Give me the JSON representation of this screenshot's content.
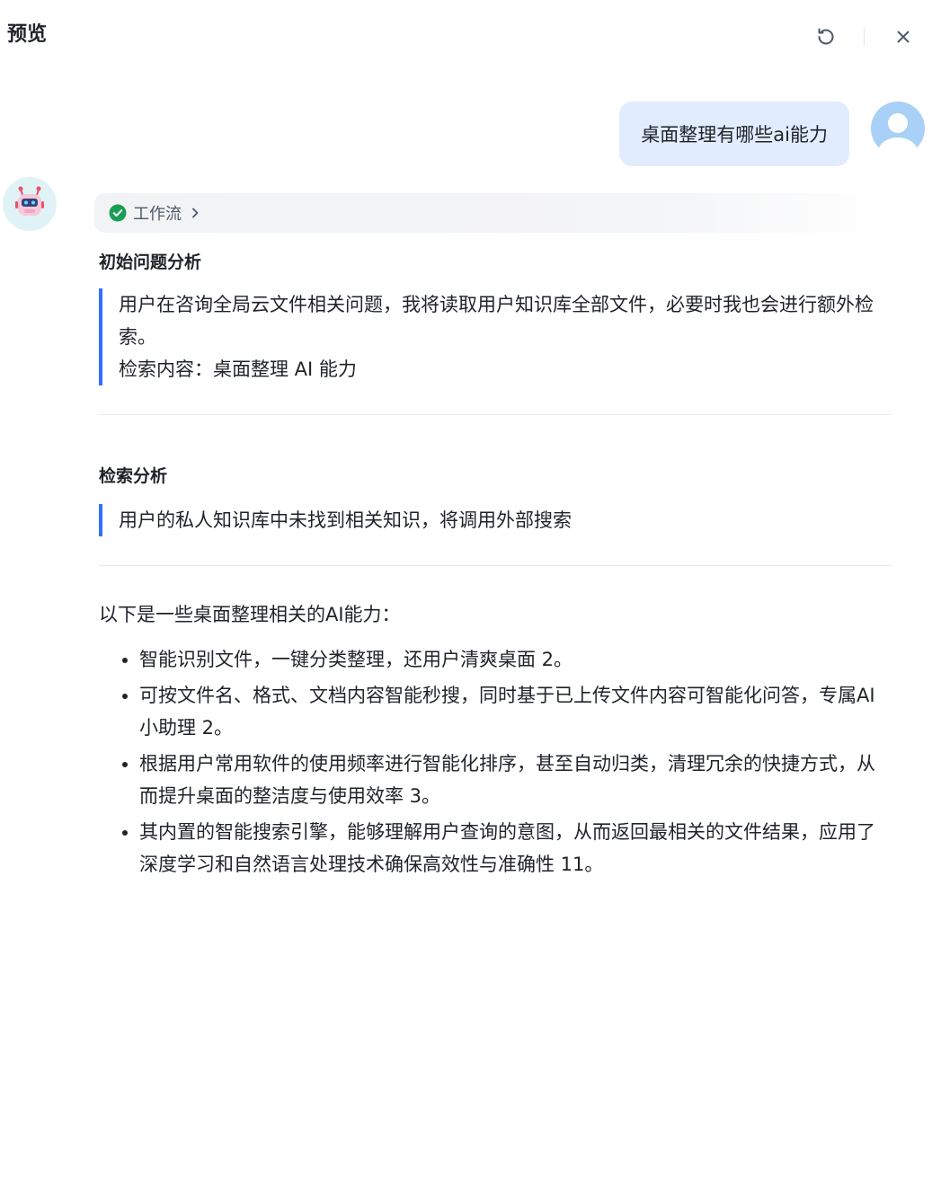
{
  "header": {
    "title": "预览"
  },
  "user_message": "桌面整理有哪些ai能力",
  "workflow": {
    "label": "工作流"
  },
  "sections": [
    {
      "title": "初始问题分析",
      "lines": [
        "用户在咨询全局云文件相关问题，我将读取用户知识库全部文件，必要时我也会进行额外检索。",
        "检索内容：桌面整理 AI 能力"
      ]
    },
    {
      "title": "检索分析",
      "lines": [
        "用户的私人知识库中未找到相关知识，将调用外部搜索"
      ]
    }
  ],
  "answer": {
    "intro": "以下是一些桌面整理相关的AI能力：",
    "bullets": [
      "智能识别文件，一键分类整理，还用户清爽桌面 2。",
      "可按文件名、格式、文档内容智能秒搜，同时基于已上传文件内容可智能化问答，专属AI小助理 2。",
      "根据用户常用软件的使用频率进行智能化排序，甚至自动归类，清理冗余的快捷方式，从而提升桌面的整洁度与使用效率 3。",
      "其内置的智能搜索引擎，能够理解用户查询的意图，从而返回最相关的文件结果，应用了深度学习和自然语言处理技术确保高效性与准确性 11。"
    ]
  },
  "icons": {
    "refresh": "refresh-icon",
    "close": "close-icon",
    "user_avatar": "user-avatar-icon",
    "bot_avatar": "robot-avatar-icon",
    "workflow_status": "check-circle-icon",
    "workflow_expand": "chevron-right-icon"
  },
  "colors": {
    "accent": "#3370ff",
    "user_bubble": "#e1edff",
    "success": "#1a9e55"
  }
}
